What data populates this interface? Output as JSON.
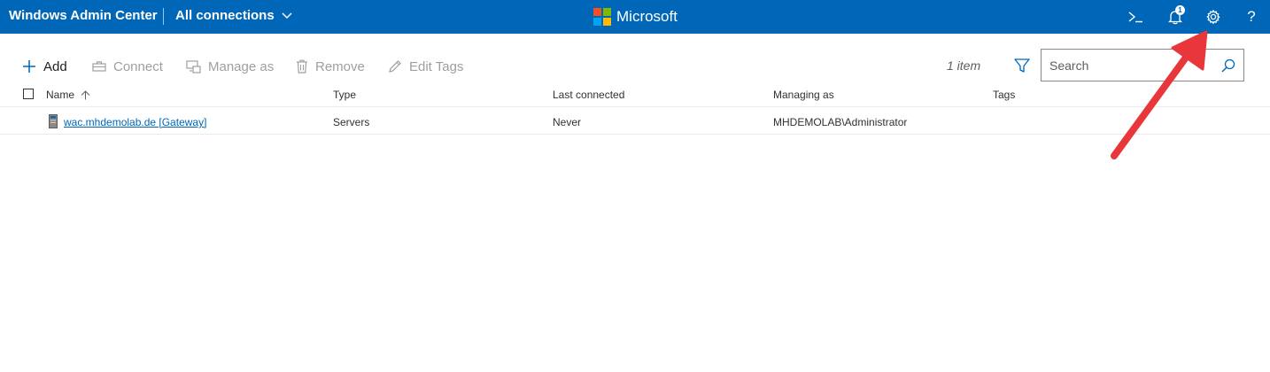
{
  "header": {
    "app_title": "Windows Admin Center",
    "connections_menu": "All connections",
    "brand": "Microsoft",
    "notification_count": "1",
    "help_glyph": "?",
    "icons": [
      "terminal-icon",
      "bell-icon",
      "gear-icon",
      "help-icon"
    ],
    "colors": {
      "bar": "#0067b8",
      "logo": [
        "#f25022",
        "#7fba00",
        "#00a4ef",
        "#ffb900"
      ]
    }
  },
  "toolbar": {
    "add_label": "Add",
    "connect_label": "Connect",
    "manage_as_label": "Manage as",
    "remove_label": "Remove",
    "edit_tags_label": "Edit Tags",
    "item_count": "1 item"
  },
  "search": {
    "placeholder": "Search",
    "value": ""
  },
  "table": {
    "columns": [
      "Name",
      "Type",
      "Last connected",
      "Managing as",
      "Tags"
    ],
    "sort_column": "Name",
    "rows": [
      {
        "name": "wac.mhdemolab.de [Gateway]",
        "type": "Servers",
        "last_connected": "Never",
        "managing_as": "MHDEMOLAB\\Administrator",
        "tags": ""
      }
    ]
  },
  "annotation": {
    "arrow_color": "#e8363b",
    "points_to": "gear-icon"
  }
}
